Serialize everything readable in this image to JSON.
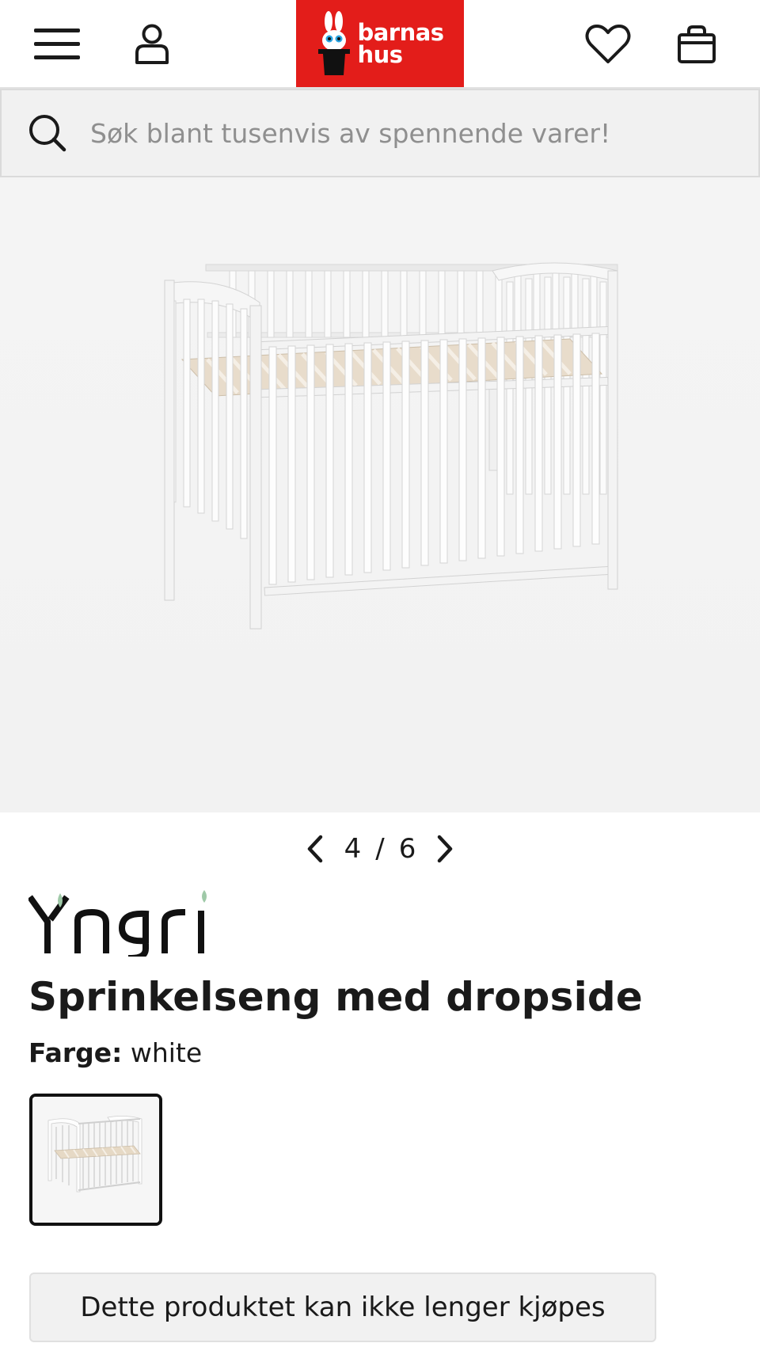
{
  "header": {
    "menu_icon": "hamburger-menu-icon",
    "account_icon": "user-icon",
    "logo": {
      "line1": "barnas",
      "line2": "hus",
      "bg_color": "#e31d1a"
    },
    "wishlist_icon": "heart-icon",
    "cart_icon": "shopping-bag-icon"
  },
  "search": {
    "placeholder": "Søk blant tusenvis av spennende varer!",
    "icon": "search-icon"
  },
  "gallery": {
    "image_alt": "Sprinkelseng med dropside",
    "current": "4",
    "separator": "/",
    "total": "6"
  },
  "product": {
    "brand": "Yngri",
    "title": "Sprinkelseng med dropside",
    "color_label": "Farge:",
    "color_value": "white",
    "unavailable_text": "Dette produktet kan ikke lenger kjøpes"
  },
  "colors": {
    "brand_red": "#e31d1a",
    "accent_leaf": "#9fc9a8",
    "text": "#1a1a1a"
  }
}
